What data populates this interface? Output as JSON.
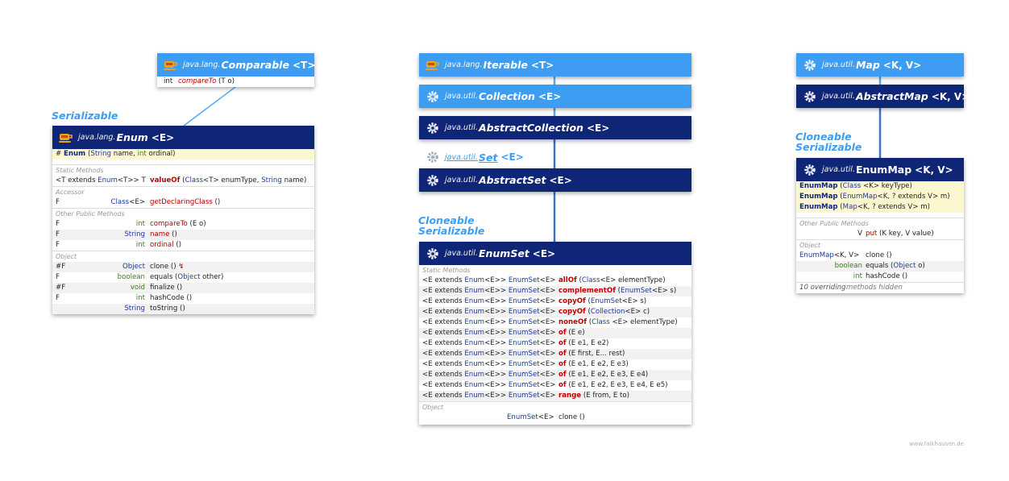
{
  "comparable": {
    "pkg": "java.lang.",
    "name": "Comparable",
    "tparam": "<T>",
    "rows": [
      {
        "type": "int",
        "name": "compareTo",
        "args": "(T o)"
      }
    ]
  },
  "enum": {
    "stereotype": "Serializable",
    "pkg": "java.lang.",
    "name": "Enum",
    "tparam": "<E>",
    "ctor": {
      "mod": "#",
      "name": "Enum",
      "args_a": "(",
      "args_t1": "String",
      "args_b": " name, ",
      "args_t2": "int",
      "args_c": " ordinal)"
    },
    "sections": {
      "static": "Static Methods",
      "accessor": "Accessor",
      "other": "Other Public Methods",
      "object": "Object"
    },
    "static_row": {
      "type_a": "<T extends ",
      "type_b": "Enum",
      "type_c": "<T>> T",
      "name": "valueOf",
      "args_a": " (",
      "args_t": "Class",
      "args_b": "<T> enumType, ",
      "args_t2": "String",
      "args_c": " name)"
    },
    "accessor_row": {
      "mod": "F",
      "type_a": "Class",
      "type_b": "<E>",
      "name": "getDeclaringClass",
      "args": " ()"
    },
    "other_rows": [
      {
        "mod": "F",
        "type": "int",
        "name": "compareTo",
        "args": " (E o)"
      },
      {
        "mod": "F",
        "type": "String",
        "name": "name",
        "args": " ()"
      },
      {
        "mod": "F",
        "type": "int",
        "name": "ordinal",
        "args": " ()"
      }
    ],
    "object_rows": [
      {
        "mod": "#F",
        "type": "Object",
        "name": "clone",
        "args": " ()",
        "extra": "↯"
      },
      {
        "mod": "F",
        "type": "boolean",
        "name": "equals",
        "args_a": " (",
        "args_t": "Object",
        "args_b": " other)"
      },
      {
        "mod": "#F",
        "type": "void",
        "name": "finalize",
        "args": " ()"
      },
      {
        "mod": "F",
        "type": "int",
        "name": "hashCode",
        "args": " ()"
      },
      {
        "mod": "",
        "type": "String",
        "name": "toString",
        "args": " ()"
      }
    ]
  },
  "iterable": {
    "pkg": "java.lang.",
    "name": "Iterable",
    "tparam": "<T>"
  },
  "collection": {
    "pkg": "java.util.",
    "name": "Collection",
    "tparam": "<E>"
  },
  "abstractcollection": {
    "pkg": "java.util.",
    "name": "AbstractCollection",
    "tparam": "<E>"
  },
  "set": {
    "pkg": "java.util.",
    "name": "Set",
    "tparam": "<E>"
  },
  "abstractset": {
    "pkg": "java.util.",
    "name": "AbstractSet",
    "tparam": "<E>"
  },
  "enumset": {
    "stereotype1": "Cloneable",
    "stereotype2": "Serializable",
    "pkg": "java.util.",
    "name": "EnumSet",
    "tparam": "<E>",
    "sec_static": "Static Methods",
    "sec_object": "Object",
    "ret_a": "<E extends ",
    "ret_b": "Enum",
    "ret_c": "<E>> ",
    "ret_d": "EnumSet",
    "ret_e": "<E>",
    "rows": [
      {
        "name": "allOf",
        "a": " (",
        "t": "Class",
        "b": "<E> elementType)"
      },
      {
        "name": "complementOf",
        "a": " (",
        "t": "EnumSet",
        "b": "<E> s)"
      },
      {
        "name": "copyOf",
        "a": " (",
        "t": "EnumSet",
        "b": "<E> s)"
      },
      {
        "name": "copyOf",
        "a": " (",
        "t": "Collection",
        "b": "<E> c)"
      },
      {
        "name": "noneOf",
        "a": " (",
        "t": "Class",
        "b": " <E> elementType)"
      },
      {
        "name": "of",
        "a": " (E e)",
        "t": "",
        "b": ""
      },
      {
        "name": "of",
        "a": " (E e1, E e2)",
        "t": "",
        "b": ""
      },
      {
        "name": "of",
        "a": " (E first, E... rest)",
        "t": "",
        "b": ""
      },
      {
        "name": "of",
        "a": " (E e1, E e2, E e3)",
        "t": "",
        "b": ""
      },
      {
        "name": "of",
        "a": " (E e1, E e2, E e3, E e4)",
        "t": "",
        "b": ""
      },
      {
        "name": "of",
        "a": " (E e1, E e2, E e3, E e4, E e5)",
        "t": "",
        "b": ""
      },
      {
        "name": "range",
        "a": " (E from, E to)",
        "t": "",
        "b": ""
      }
    ],
    "clone_type_a": "EnumSet",
    "clone_type_b": "<E>",
    "clone_name": "clone ()"
  },
  "map": {
    "pkg": "java.util.",
    "name": "Map",
    "tparam": "<K, V>"
  },
  "abstractmap": {
    "pkg": "java.util.",
    "name": "AbstractMap",
    "tparam": "<K, V>"
  },
  "enummap": {
    "stereotype1": "Cloneable",
    "stereotype2": "Serializable",
    "pkg": "java.util.",
    "name": "EnumMap",
    "tparam": "<K, V>",
    "ctors": [
      {
        "name": "EnumMap",
        "a": " (",
        "t": "Class",
        "b": " <K> keyType)"
      },
      {
        "name": "EnumMap",
        "a": " (",
        "t": "EnumMap",
        "b": "<K, ? extends V> m)"
      },
      {
        "name": "EnumMap",
        "a": " (",
        "t": "Map",
        "b": "<K, ? extends V> m)"
      }
    ],
    "sec_other": "Other Public Methods",
    "sec_object": "Object",
    "put_row": {
      "type": "V",
      "name": "put",
      "args": " (K key, V value)"
    },
    "clone_row": {
      "type_a": "EnumMap",
      "type_b": "<K, V>",
      "name": "clone ()"
    },
    "equals_row": {
      "type": "boolean",
      "name": "equals (",
      "t": "Object",
      "b": " o)"
    },
    "hash_row": {
      "type": "int",
      "name": "hashCode ()"
    },
    "hidden_count": "10 overriding",
    "hidden_text": " methods hidden"
  },
  "footer": "www.falkhausen.de",
  "colors": {
    "light": "#3d9df2",
    "dark": "#0f2575",
    "line": "#3d73c9"
  }
}
